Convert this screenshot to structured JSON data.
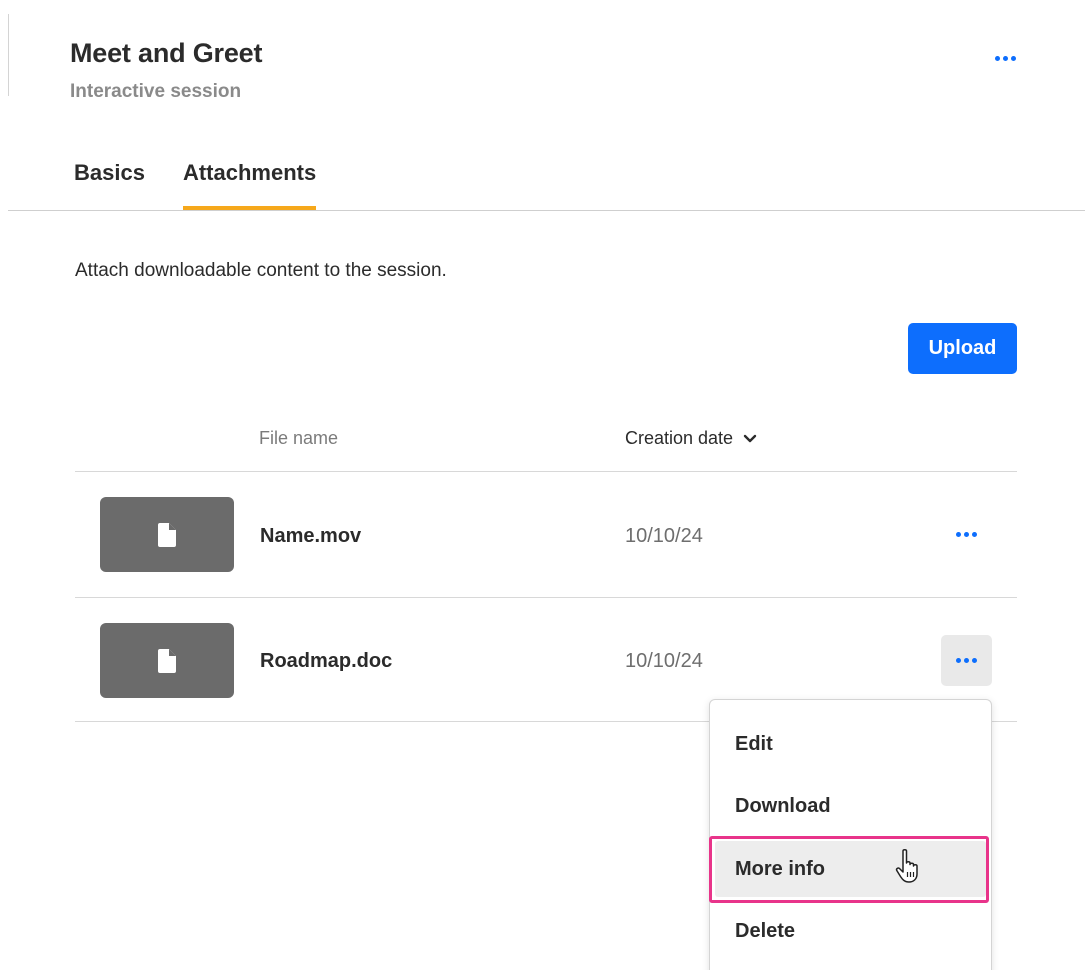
{
  "header": {
    "title": "Meet and Greet",
    "subtitle": "Interactive session",
    "menu_icon": "more-horizontal-icon"
  },
  "tabs": [
    {
      "label": "Basics",
      "active": false
    },
    {
      "label": "Attachments",
      "active": true
    }
  ],
  "attachments": {
    "description": "Attach downloadable content to the session.",
    "upload_label": "Upload",
    "columns": {
      "file_name": "File name",
      "creation_date": "Creation date",
      "sort_icon": "chevron-down-icon"
    },
    "rows": [
      {
        "file_name": "Name.mov",
        "date": "10/10/24",
        "thumbnail_icon": "file-icon"
      },
      {
        "file_name": "Roadmap.doc",
        "date": "10/10/24",
        "thumbnail_icon": "file-icon"
      }
    ]
  },
  "row_menu": {
    "items": [
      {
        "label": "Edit"
      },
      {
        "label": "Download"
      },
      {
        "label": "More info",
        "hovered": true
      },
      {
        "label": "Delete"
      }
    ]
  },
  "colors": {
    "primary": "#0d6efd",
    "tab_underline": "#f6a81b",
    "highlight": "#e8348a",
    "thumbnail": "#6b6b6b"
  }
}
